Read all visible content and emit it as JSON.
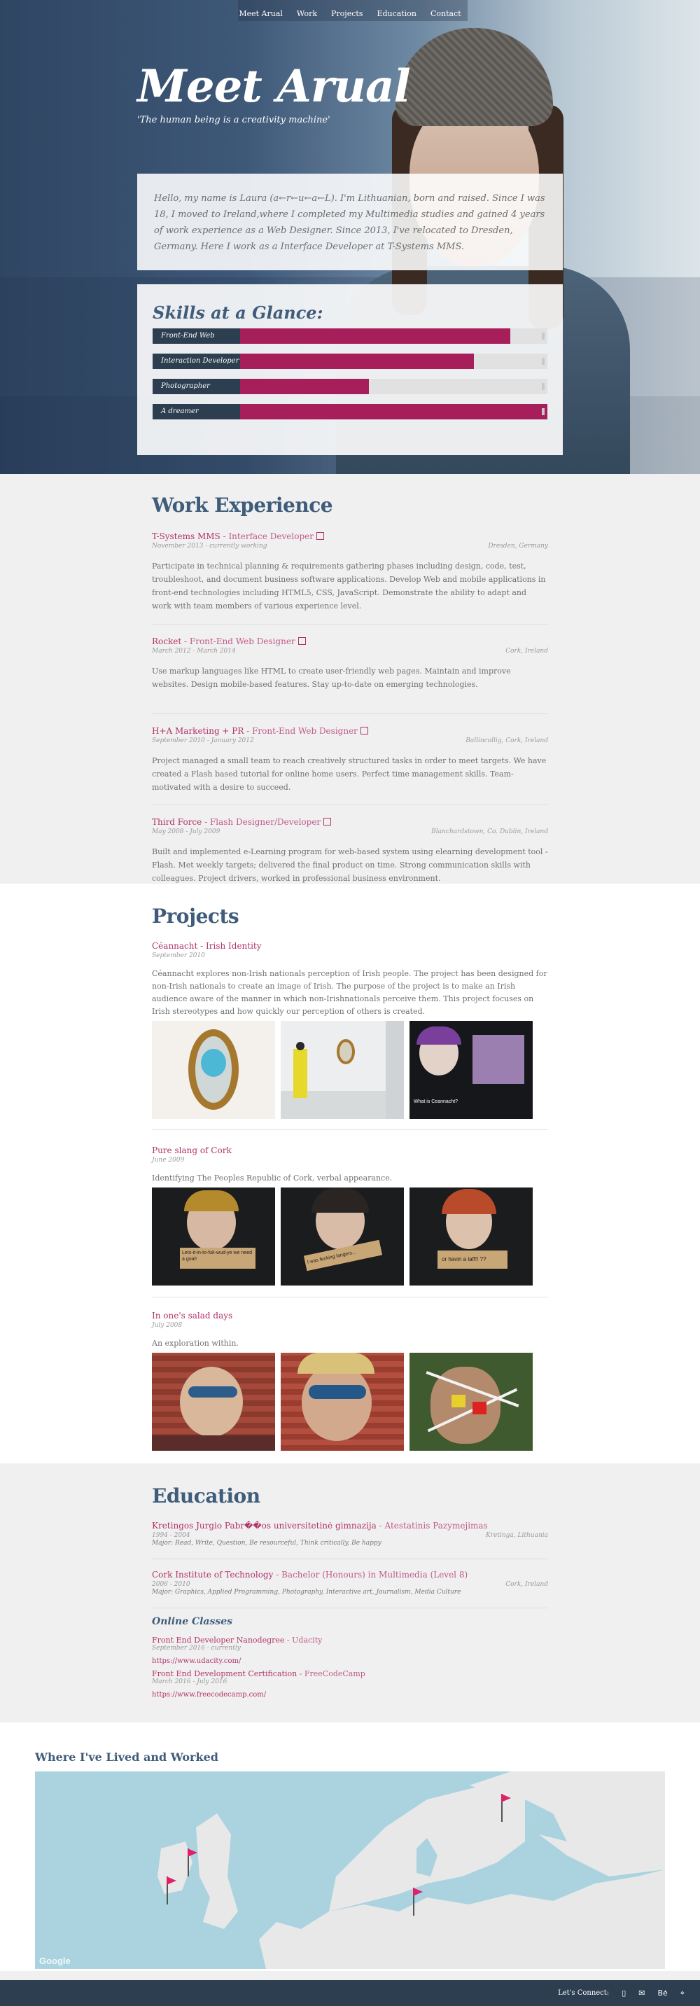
{
  "nav": {
    "items": [
      "Meet Arual",
      "Work",
      "Projects",
      "Education",
      "Contact"
    ]
  },
  "hero": {
    "title": "Meet Arual",
    "subtitle": "'The human being is a creativity machine'",
    "intro": "Hello, my name is Laura (a←r←u←a←L). I'm Lithuanian, born and raised. Since I was 18, I moved to Ireland,where I completed my Multimedia studies and gained 4 years of work experience as a Web Designer. Since 2013, I've relocated to Dresden, Germany. Here I work as a Interface Developer at T-Systems MMS."
  },
  "skills": {
    "title": "Skills at a Glance:",
    "items": [
      {
        "label": "Front-End Web",
        "level": 0.88
      },
      {
        "label": "Interaction Developer",
        "level": 0.76
      },
      {
        "label": "Photographer",
        "level": 0.42
      },
      {
        "label": "A dreamer",
        "level": 1.0
      }
    ]
  },
  "work": {
    "title": "Work Experience",
    "jobs": [
      {
        "company": "T-Systems MMS",
        "role": "Interface Developer",
        "dates": "November 2013 - currently working",
        "location": "Dresden, Germany",
        "desc": "Participate in technical planning & requirements gathering phases including design, code, test, troubleshoot, and document business software applications. Develop Web and mobile applications in front-end technologies including HTML5, CSS, JavaScript. Demonstrate the ability to adapt and work with team members of various experience level."
      },
      {
        "company": "Rocket",
        "role": "Front-End Web Designer",
        "dates": "March 2012 - March 2014",
        "location": "Cork, Ireland",
        "desc": "Use markup languages like HTML to create user-friendly web pages. Maintain and improve websites. Design mobile-based features. Stay up-to-date on emerging technologies."
      },
      {
        "company": "H+A Marketing + PR",
        "role": "Front-End Web Designer",
        "dates": "September 2010 - January 2012",
        "location": "Ballincollig, Cork, Ireland",
        "desc": "Project managed a small team to reach creatively structured tasks in order to meet targets. We have created a Flash based tutorial for online home users. Perfect time management skills. Team-motivated with a desire to succeed."
      },
      {
        "company": "Third Force",
        "role": "Flash Designer/Developer",
        "dates": "May 2008 - July 2009",
        "location": "Blanchardstown, Co. Dublin, Ireland",
        "desc": "Built and implemented e-Learning program for web-based system using elearning development tool - Flash. Met weekly targets; delivered the final product on time. Strong communication skills with colleagues. Project drivers, worked in professional business environment."
      }
    ]
  },
  "projects": {
    "title": "Projects",
    "items": [
      {
        "title": "Céannacht - Irish Identity",
        "date": "September 2010",
        "desc": "Céannacht explores non-Irish nationals perception of Irish people. The project has been designed for non-Irish nationals to create an image of Irish. The purpose of the project is to make an Irish audience aware of the manner in which non-Irishnationals perceive them. This project focuses on Irish stereotypes and how quickly our perception of others is created."
      },
      {
        "title": "Pure slang of Cork",
        "date": "June 2009",
        "desc": "Identifying The Peoples Republic of Cork, verbal appearance.",
        "signs": [
          "Lets-it-in-to-fuk-wud-ye we need a goal!",
          "I was fecking langers...",
          "or havin a laff!! ??"
        ]
      },
      {
        "title": "In one's salad days",
        "date": "July 2008",
        "desc": "An exploration within."
      }
    ],
    "thumb_text": "What is Ceannacht?"
  },
  "education": {
    "title": "Education",
    "schools": [
      {
        "name": "Kretingos Jurgio Pabr��os universitetinė gimnazija",
        "degree": "Atestatinis Pazymejimas",
        "dates": "1994 - 2004",
        "location": "Kretinga, Lithuania",
        "major": "Major: Read, Write, Question, Be resourceful, Think critically, Be happy"
      },
      {
        "name": "Cork Institute of Technology",
        "degree": "Bachelor (Honours) in Multimedia (Level 8)",
        "dates": "2006 - 2010",
        "location": "Cork, Ireland",
        "major": "Major: Graphics, Applied Programming, Photography, Interactive art, Journalism, Media Culture"
      }
    ],
    "online_title": "Online Classes",
    "online": [
      {
        "name": "Front End Developer Nanodegree",
        "provider": "Udacity",
        "dates": "September 2016 - currently",
        "url": "https://www.udacity.com/"
      },
      {
        "name": "Front End Development Certification",
        "provider": "FreeCodeCamp",
        "dates": "March 2016 - July 2016",
        "url": "https://www.freecodecamp.com/"
      }
    ]
  },
  "map": {
    "title": "Where I've Lived and Worked",
    "attribution": "Google"
  },
  "footer": {
    "connect": "Let's Connect:",
    "icons": [
      "mobile-icon",
      "mail-icon",
      "behance-icon",
      "location-icon"
    ],
    "behance_text": "Bė"
  },
  "colors": {
    "navy": "#2c3e50",
    "heading": "#3f5c7a",
    "accent": "#a61e5a",
    "link": "#b23268"
  }
}
